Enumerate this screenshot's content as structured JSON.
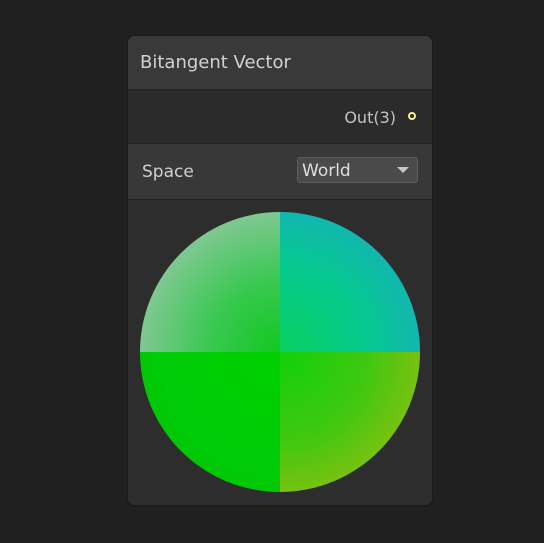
{
  "node": {
    "title": "Bitangent Vector",
    "output_port": {
      "label": "Out(3)",
      "color": "#f2f299"
    },
    "space_control": {
      "label": "Space",
      "selected": "World"
    },
    "preview": {
      "icon": "sphere-preview"
    }
  }
}
